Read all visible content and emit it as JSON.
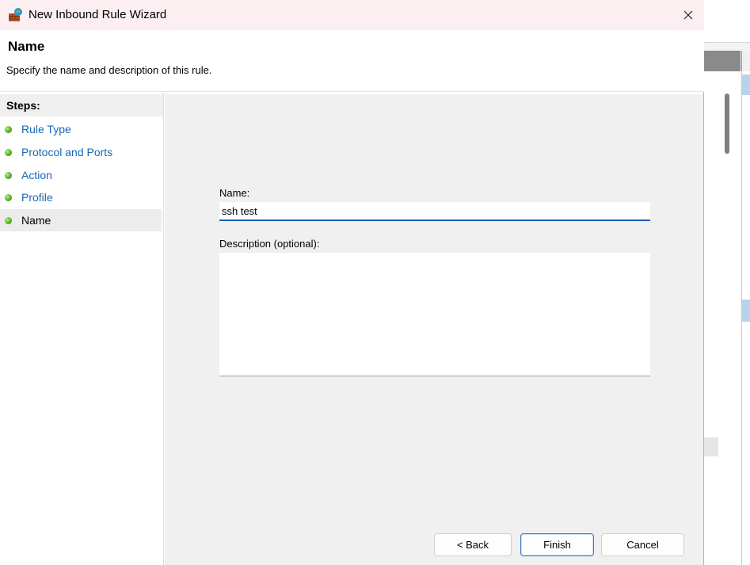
{
  "window": {
    "title": "New Inbound Rule Wizard",
    "close_icon": "close-icon",
    "app_icon": "firewall-rule-icon"
  },
  "header": {
    "title": "Name",
    "subtitle": "Specify the name and description of this rule."
  },
  "steps": {
    "title": "Steps:",
    "items": [
      {
        "label": "Rule Type",
        "current": false
      },
      {
        "label": "Protocol and Ports",
        "current": false
      },
      {
        "label": "Action",
        "current": false
      },
      {
        "label": "Profile",
        "current": false
      },
      {
        "label": "Name",
        "current": true
      }
    ],
    "status_icon": "green-dot-icon"
  },
  "form": {
    "name_label": "Name:",
    "name_value": "ssh test",
    "description_label": "Description (optional):",
    "description_value": ""
  },
  "buttons": {
    "back": "< Back",
    "finish": "Finish",
    "cancel": "Cancel"
  },
  "colors": {
    "link": "#1a66b8",
    "focus": "#1a5fb4",
    "titlebar": "#fbeff1"
  }
}
